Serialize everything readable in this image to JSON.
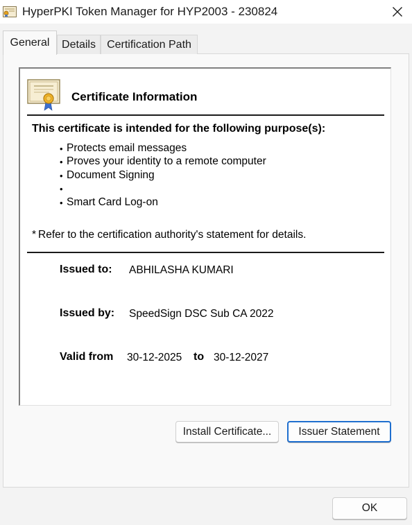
{
  "window": {
    "title": "HyperPKI Token Manager for HYP2003 - 230824",
    "app_icon": "certificate-icon",
    "close_icon": "close-icon"
  },
  "tabs": [
    {
      "label": "General",
      "active": true
    },
    {
      "label": "Details",
      "active": false
    },
    {
      "label": "Certification Path",
      "active": false
    }
  ],
  "certificate": {
    "icon": "certificate-ribbon-icon",
    "heading": "Certificate Information",
    "purpose_heading": "This certificate is intended for the following purpose(s):",
    "purposes": [
      "Protects email messages",
      "Proves your identity to a remote computer",
      "Document Signing",
      "",
      "Smart Card Log-on"
    ],
    "note_marker": "*",
    "note": "Refer to the certification authority's statement for details.",
    "issued_to_label": "Issued to:",
    "issued_to": "ABHILASHA KUMARI",
    "issued_by_label": "Issued by:",
    "issued_by": "SpeedSign DSC Sub CA 2022",
    "valid_from_label": "Valid from",
    "valid_from": "30-12-2025",
    "to_label": "to",
    "valid_to": "30-12-2027"
  },
  "buttons": {
    "install_certificate": "Install Certificate...",
    "issuer_statement": "Issuer Statement",
    "ok": "OK"
  },
  "colors": {
    "focus_accent": "#1f6fcf"
  }
}
